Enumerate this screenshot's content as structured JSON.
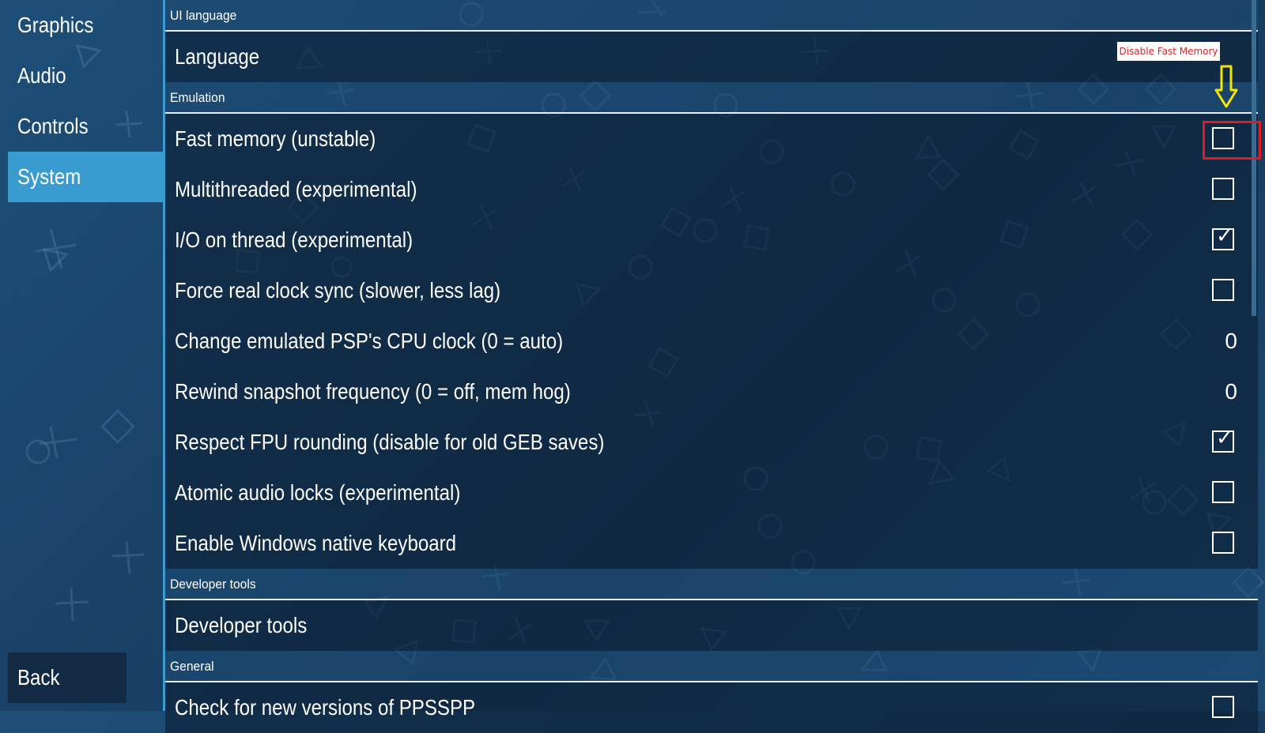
{
  "sidebar": {
    "tabs": [
      {
        "label": "Graphics"
      },
      {
        "label": "Audio"
      },
      {
        "label": "Controls"
      },
      {
        "label": "System"
      }
    ],
    "back_label": "Back"
  },
  "sections": {
    "ui_language": {
      "header": "UI language",
      "language_label": "Language"
    },
    "emulation": {
      "header": "Emulation",
      "items": [
        {
          "label": "Fast memory (unstable)",
          "checked": false
        },
        {
          "label": "Multithreaded (experimental)",
          "checked": false
        },
        {
          "label": "I/O on thread (experimental)",
          "checked": true
        },
        {
          "label": "Force real clock sync (slower, less lag)",
          "checked": false
        },
        {
          "label": "Change emulated PSP's CPU clock (0 = auto)",
          "value": "0"
        },
        {
          "label": "Rewind snapshot frequency (0 = off, mem hog)",
          "value": "0"
        },
        {
          "label": "Respect FPU rounding (disable for old GEB saves)",
          "checked": true
        },
        {
          "label": "Atomic audio locks (experimental)",
          "checked": false
        },
        {
          "label": "Enable Windows native keyboard",
          "checked": false
        }
      ]
    },
    "developer_tools": {
      "header": "Developer tools",
      "item_label": "Developer tools"
    },
    "general": {
      "header": "General",
      "item_label": "Check for new versions of PPSSPP",
      "item_checked": false
    }
  },
  "annotation": {
    "label": "Disable Fast Memory",
    "arrow_color": "#f2e600",
    "box_color": "#e21b23"
  },
  "colors": {
    "accent": "#3a9bd1",
    "background": "#1a4268"
  }
}
